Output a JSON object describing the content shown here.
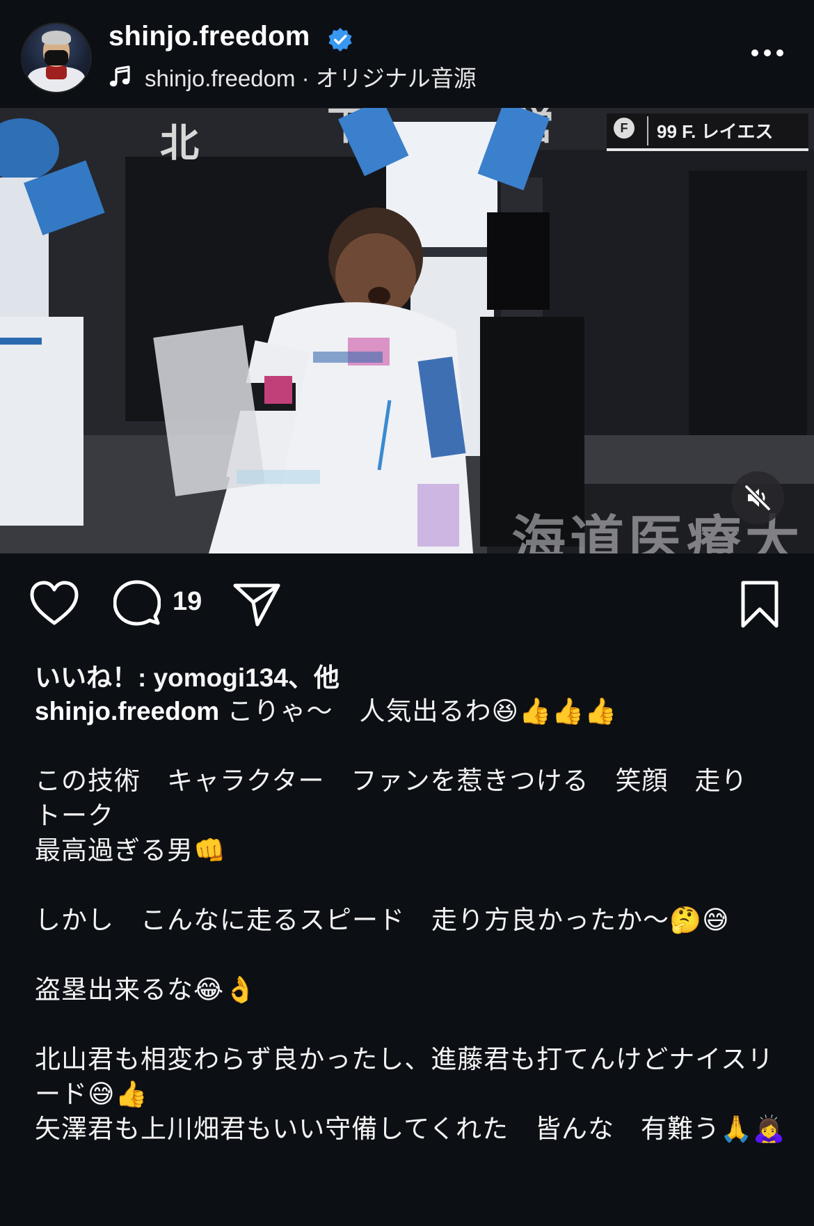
{
  "header": {
    "username": "shinjo.freedom",
    "verified": true,
    "audio_text": "shinjo.freedom · オリジナル音源",
    "icons": [
      "avatar",
      "verified-badge-icon",
      "music-note-icon",
      "more-options-icon"
    ]
  },
  "video": {
    "scorebug_team": "F",
    "scorebug_player": "99  F. レイエス",
    "banner_text": "海道医療大",
    "muted": true,
    "icons": [
      "mute-icon"
    ]
  },
  "actions": {
    "comment_count": "19",
    "icons": [
      "heart-icon",
      "comment-icon",
      "share-icon",
      "bookmark-icon"
    ]
  },
  "caption": {
    "likes_text": "いいね！: yomogi134、他",
    "author": "shinjo.freedom",
    "body": " こりゃ〜　人気出るわ😆👍👍👍\n\nこの技術　キャラクター　ファンを惹きつける　笑顔　走り　トーク\n最高過ぎる男👊\n\nしかし　こんなに走るスピード　走り方良かったか〜🤔😅\n\n盗塁出来るな😂👌\n\n北山君も相変わらず良かったし、進藤君も打てんけどナイスリード😅👍\n矢澤君も上川畑君もいい守備してくれた　皆んな　有難う🙏🙇‍♀️"
  },
  "colors": {
    "background": "#0c0f14",
    "text": "#f5f5f5",
    "verified_blue": "#3897f0"
  }
}
